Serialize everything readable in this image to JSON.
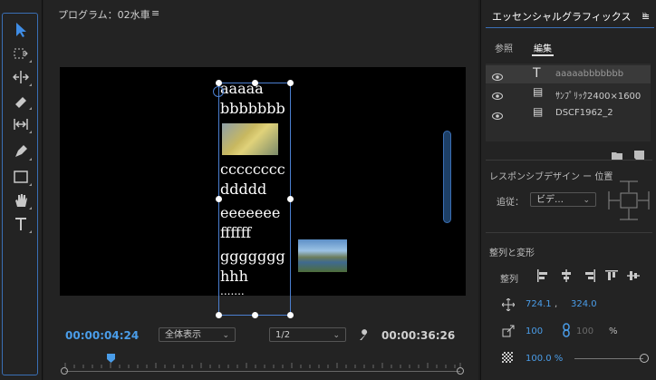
{
  "program_monitor": {
    "title": "プログラム：02水車",
    "menu_icon": "≡",
    "video_text": [
      "aaaaa",
      "bbbbbbb",
      "cccccccc",
      "ddddd",
      "eeeeeee",
      "ffffff",
      "ggggggg",
      "hhh",
      "......."
    ],
    "current_timecode": "00:00:04:24",
    "zoom_select": "全体表示",
    "resolution_select": "1/2",
    "duration_timecode": "00:00:36:26"
  },
  "essential_graphics": {
    "title": "エッセンシャルグラフィックス",
    "title_suffix": "≡",
    "close_label": "»",
    "tabs": {
      "browse": "参照",
      "edit": "編集"
    },
    "layers": [
      {
        "type": "T",
        "name": "aaaaabbbbbbb",
        "selected": true
      },
      {
        "type": "▤",
        "name": "ｻﾝﾌﾟﾘｯｸ2400×1600",
        "selected": false
      },
      {
        "type": "▤",
        "name": "DSCF1962_2",
        "selected": false
      }
    ],
    "responsive_title": "レスポンシブデザイン ー 位置",
    "follow_label": "追従：",
    "follow_value": "ビデ…",
    "align_section": "整列と変形",
    "align_label": "整列",
    "position_x": "724.1",
    "position_sep": ",",
    "position_y": "324.0",
    "scale_value": "100",
    "scale_value2": "100",
    "scale_unit": "%",
    "opacity_value": "100.0 %"
  },
  "colors": {
    "accent": "#4a9de9",
    "panel_bg": "#232323",
    "video_bg": "#000000"
  }
}
